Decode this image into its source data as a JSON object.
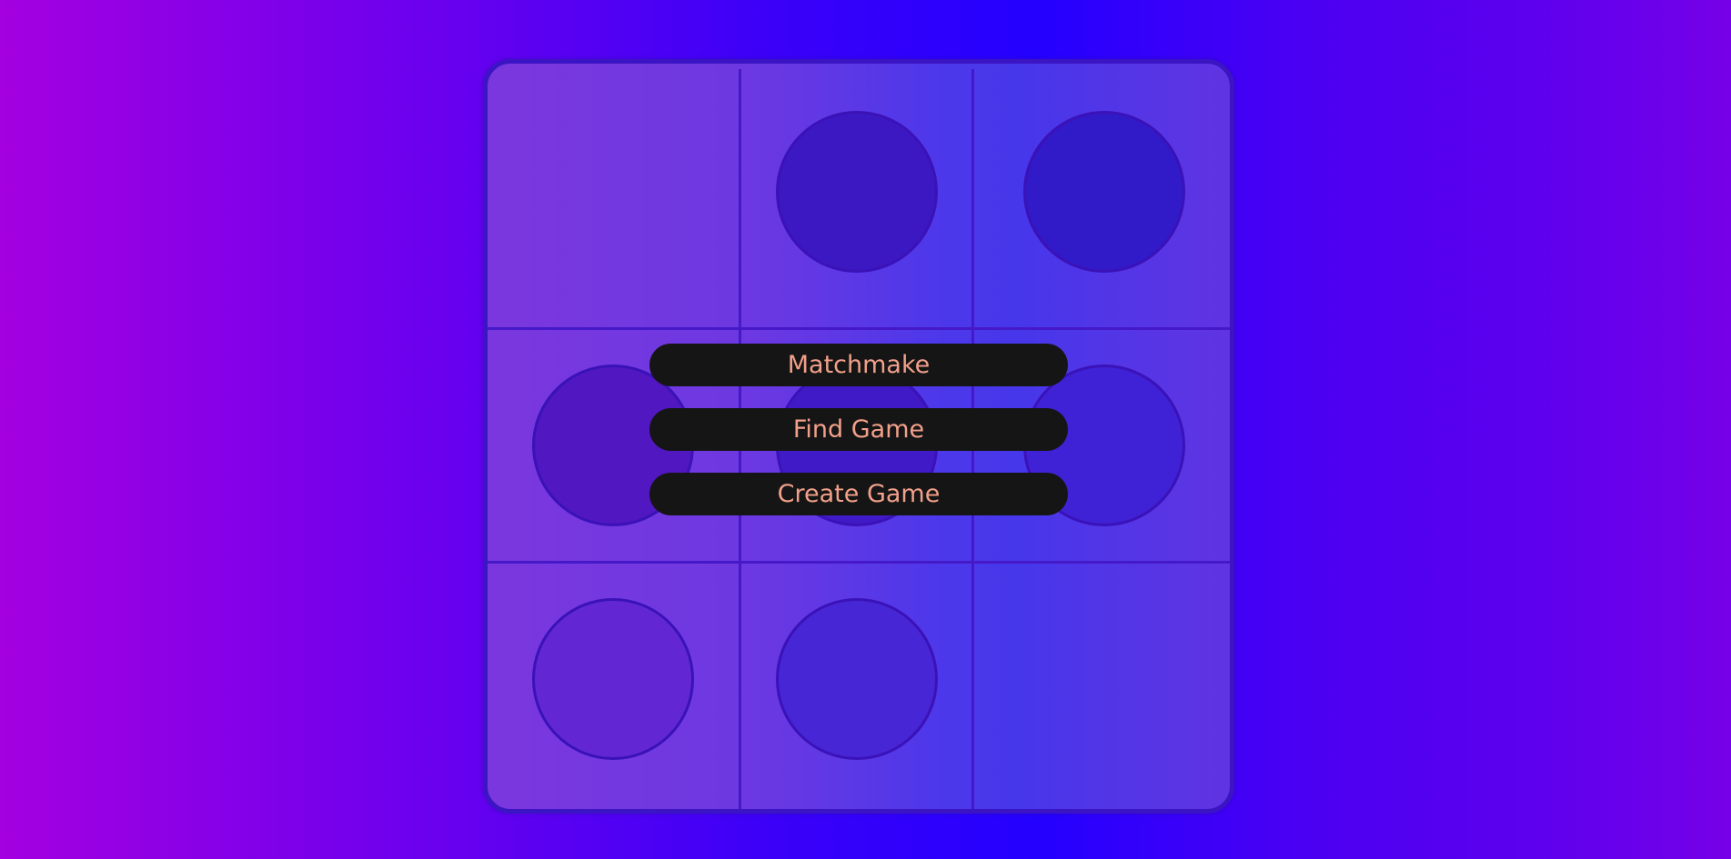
{
  "theme": {
    "accent_text": "#f2a08a",
    "button_bg": "#151515",
    "board_border": "#3b14c4"
  },
  "board": {
    "rows": [
      [
        {
          "token": false,
          "color": ""
        },
        {
          "token": true,
          "color": "#3c18c2"
        },
        {
          "token": true,
          "color": "#311ac8"
        }
      ],
      [
        {
          "token": true,
          "color": "#5117c0"
        },
        {
          "token": true,
          "color": "#3f1ac6"
        },
        {
          "token": true,
          "color": "#3f22d6"
        }
      ],
      [
        {
          "token": true,
          "color": "#6227d2"
        },
        {
          "token": true,
          "color": "#4726d6"
        },
        {
          "token": false,
          "color": ""
        }
      ]
    ]
  },
  "menu": {
    "matchmake_label": "Matchmake",
    "find_game_label": "Find Game",
    "create_game_label": "Create Game"
  }
}
